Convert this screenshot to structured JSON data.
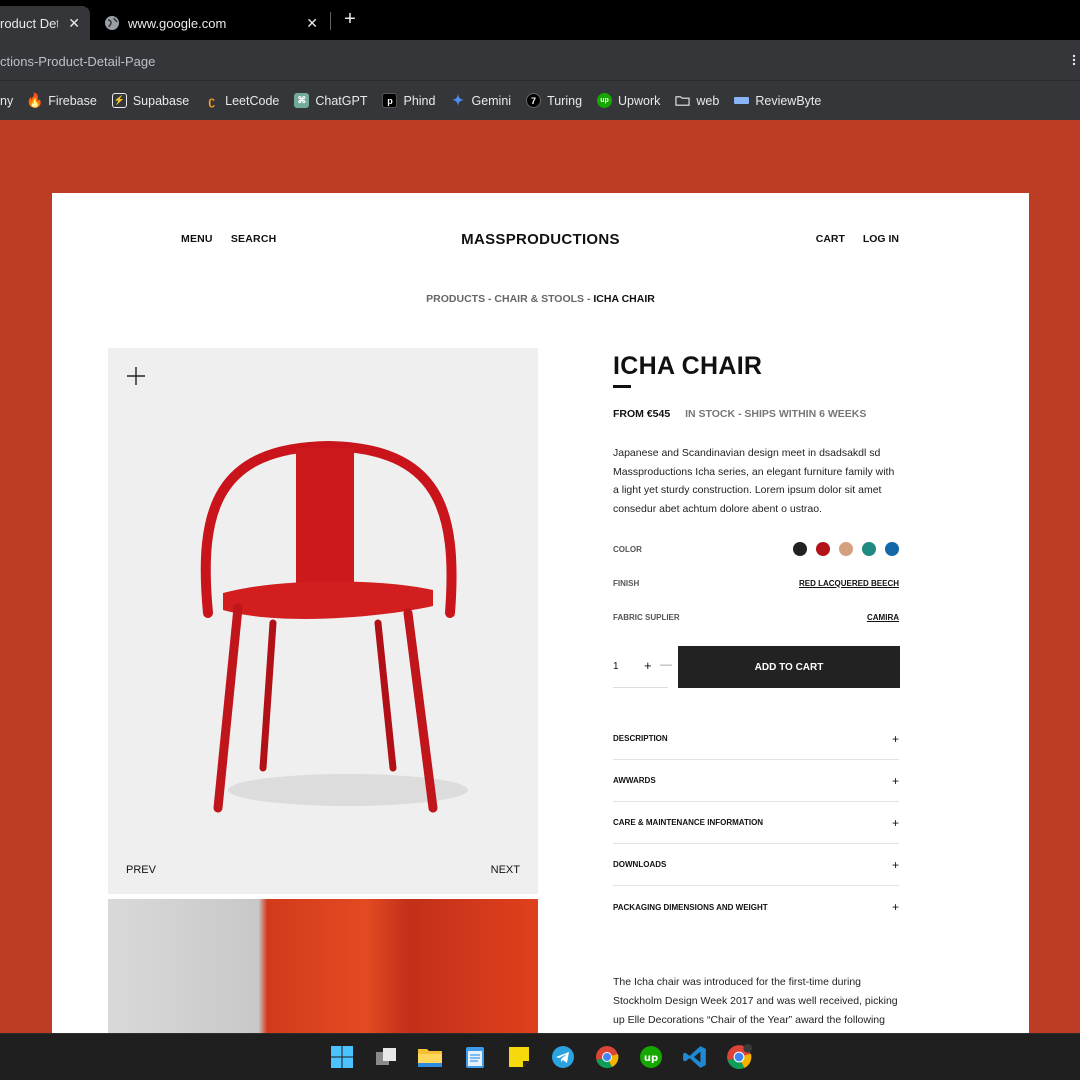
{
  "browser": {
    "tabs": [
      {
        "title": "roduct Det",
        "active": true
      },
      {
        "title": "www.google.com",
        "active": false
      }
    ],
    "address": "ctions-Product-Detail-Page",
    "bookmarks": [
      {
        "label": "ny",
        "icon": "partial-icon"
      },
      {
        "label": "Firebase",
        "icon": "firebase-icon"
      },
      {
        "label": "Supabase",
        "icon": "supabase-icon"
      },
      {
        "label": "LeetCode",
        "icon": "leetcode-icon"
      },
      {
        "label": "ChatGPT",
        "icon": "chatgpt-icon"
      },
      {
        "label": "Phind",
        "icon": "phind-icon"
      },
      {
        "label": "Gemini",
        "icon": "gemini-icon"
      },
      {
        "label": "Turing",
        "icon": "turing-icon"
      },
      {
        "label": "Upwork",
        "icon": "upwork-icon"
      },
      {
        "label": "web",
        "icon": "folder-icon"
      },
      {
        "label": "ReviewByte",
        "icon": "reviewbyte-icon"
      }
    ]
  },
  "site": {
    "nav_left": [
      "MENU",
      "SEARCH"
    ],
    "logo": "MASSPRODUCTIONS",
    "nav_right": [
      "CART",
      "LOG IN"
    ],
    "breadcrumb": {
      "path": "PRODUCTS - CHAIR & STOOLS - ",
      "current": "ICHA CHAIR"
    }
  },
  "gallery": {
    "prev": "PREV",
    "next": "NEXT"
  },
  "product": {
    "title": "ICHA CHAIR",
    "price": "FROM €545",
    "stock": "IN STOCK - SHIPS WITHIN 6 WEEKS",
    "description": "Japanese and Scandinavian design meet in dsadsakdl sd Massproductions Icha series, an elegant furniture family with a light yet sturdy construction. Lorem ipsum dolor sit amet consedur abet achtum dolore abent o ustrao.",
    "color_label": "COLOR",
    "colors": [
      "#222222",
      "#b3121a",
      "#d4a080",
      "#1e8a80",
      "#1468a8"
    ],
    "finish_label": "FINISH",
    "finish_value": "RED LACQUERED BEECH",
    "fabric_label": "FABRIC SUPLIER",
    "fabric_value": "CAMIRA",
    "quantity": "1",
    "qty_plus": "+",
    "qty_minus": "—",
    "add_to_cart": "ADD TO CART",
    "accordion": [
      "DESCRIPTION",
      "AWWARDS",
      "CARE & MAINTENANCE INFORMATION",
      "DOWNLOADS",
      "PACKAGING DIMENSIONS AND WEIGHT"
    ],
    "story": "The Icha chair was introduced for the first-time during Stockholm Design Week 2017 and was well received, picking up Elle Decorations “Chair of the Year” award the following"
  },
  "taskbar": [
    "windows-start-icon",
    "task-view-icon",
    "file-explorer-icon",
    "notepad-icon",
    "sticky-notes-icon",
    "telegram-icon",
    "chrome-icon",
    "upwork-icon",
    "vscode-icon",
    "chrome-profile-icon"
  ]
}
